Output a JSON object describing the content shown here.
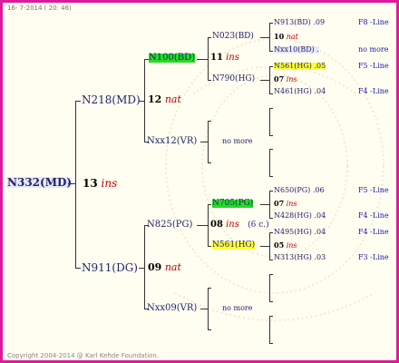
{
  "header": {
    "date": "16- 7-2014 ( 20: 46)"
  },
  "footer": {
    "copyright": "Copyright 2004-2014 @ Karl Kehde Foundation."
  },
  "gen1": {
    "id": "N332(MD)"
  },
  "gen2": [
    {
      "id": "N218(MD)",
      "year": "13",
      "tag": "ins"
    },
    {
      "id": "N911(DG)"
    }
  ],
  "gen3": [
    {
      "id": "N100(BD)",
      "year": "12",
      "tag": "nat"
    },
    {
      "id": "Nxx12(VR)"
    },
    {
      "id": "N825(PG)",
      "year": "09",
      "tag": "nat"
    },
    {
      "id": "Nxx09(VR)"
    }
  ],
  "gen4": [
    {
      "id": "N023(BD)",
      "year": "11",
      "tag": "ins"
    },
    {
      "id": "N790(HG)"
    },
    {
      "id": "no more"
    },
    {
      "id": "N705(PG)",
      "year": "08",
      "tag": "ins",
      "extra": "(6 c.)"
    },
    {
      "id": "N561(HG)"
    },
    {
      "id": "no more"
    }
  ],
  "gen5": [
    {
      "id": "N913(BD)",
      "year": ".09",
      "line": "F8 -Line"
    },
    {
      "id": "10",
      "tag": "nat"
    },
    {
      "id": "Nxx10(BD)",
      "year": ".",
      "line": "no more"
    },
    {
      "id": "N561(HG)",
      "year": ".05",
      "line": "F5 -Line"
    },
    {
      "id": "07",
      "tag": "ins"
    },
    {
      "id": "N461(HG)",
      "year": ".04",
      "line": "F4 -Line"
    },
    {
      "id": "N650(PG)",
      "year": ".06",
      "line": "F5 -Line"
    },
    {
      "id": "07",
      "tag": "ins"
    },
    {
      "id": "N428(HG)",
      "year": ".04",
      "line": "F4 -Line"
    },
    {
      "id": "N495(HG)",
      "year": ".04",
      "line": "F4 -Line"
    },
    {
      "id": "05",
      "tag": "ins"
    },
    {
      "id": "N313(HG)",
      "year": ".03",
      "line": "F3 -Line"
    }
  ],
  "colors": {
    "border": "#e0199a",
    "highlight_green": "#22dd22",
    "highlight_yellow": "#ffff33",
    "line_text": "#1a1aa8"
  }
}
